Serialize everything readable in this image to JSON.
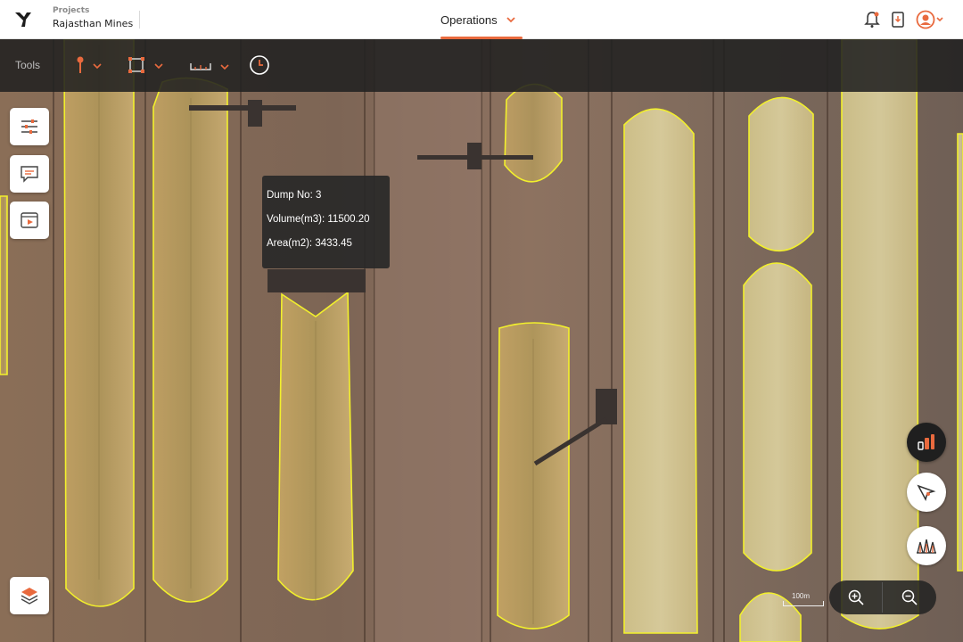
{
  "header": {
    "project_caption": "Projects",
    "project_name": "Rajasthan Mines",
    "active_tab": "Operations",
    "icons": [
      "logo-icon",
      "bell-icon",
      "report-download-icon",
      "user-avatar-icon"
    ],
    "accent_color": "#e96a3e"
  },
  "toolbar": {
    "label": "Tools",
    "tools": [
      "pin-tool-icon",
      "area-select-tool-icon",
      "measure-tool-icon",
      "history-clock-icon"
    ]
  },
  "sidebar": {
    "buttons": [
      "filters-sliders-icon",
      "comments-icon",
      "video-playback-icon",
      "layers-icon"
    ]
  },
  "tooltip": {
    "dump": "Dump No: 3",
    "volume": "Volume(m3): 11500.20",
    "area": "Area(m2): 3433.45"
  },
  "map_controls": {
    "buttons": [
      "stockpile-chart-icon",
      "select-cursor-icon",
      "stockpile-profile-icon",
      "zoom-in-icon",
      "zoom-out-icon"
    ],
    "scale_label": "100m"
  }
}
